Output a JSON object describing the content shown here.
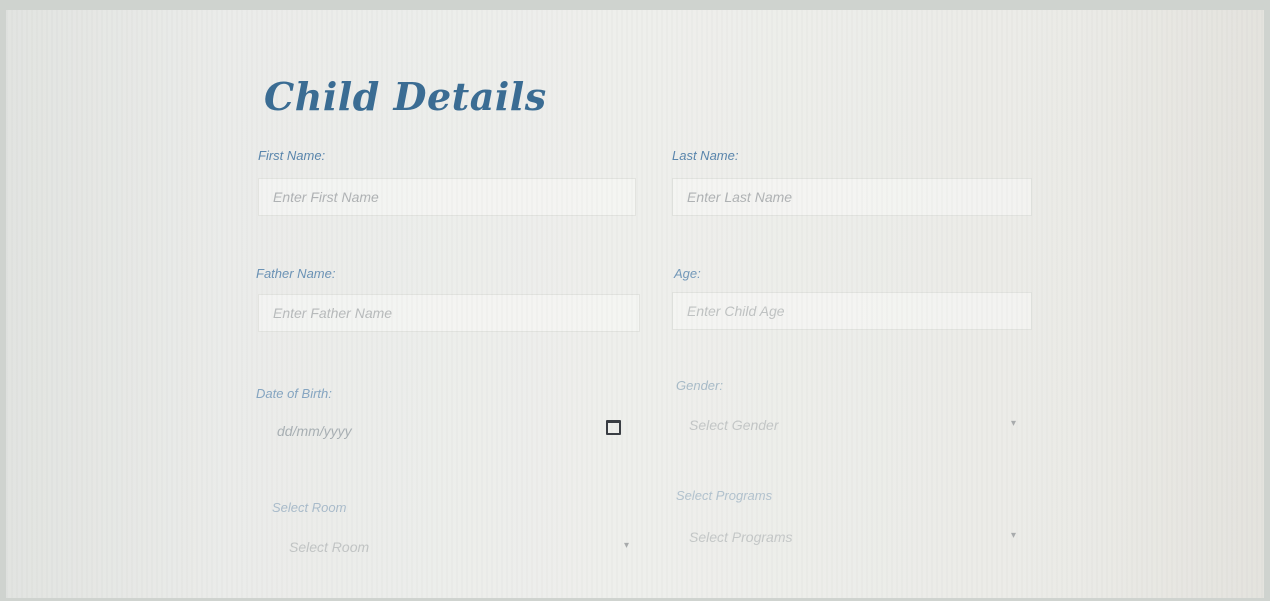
{
  "form": {
    "title": "Child Details",
    "first_name": {
      "label": "First Name:",
      "placeholder": "Enter First Name"
    },
    "last_name": {
      "label": "Last Name:",
      "placeholder": "Enter Last Name"
    },
    "father_name": {
      "label": "Father Name:",
      "placeholder": "Enter Father Name"
    },
    "age": {
      "label": "Age:",
      "placeholder": "Enter Child Age"
    },
    "dob": {
      "label": "Date of Birth:",
      "placeholder": "dd/mm/yyyy"
    },
    "gender": {
      "label": "Gender:",
      "selected": "Select Gender"
    },
    "room": {
      "label": "Select Room",
      "selected": "Select Room"
    },
    "programs": {
      "label": "Select Programs",
      "selected": "Select Programs"
    }
  },
  "icons": {
    "calendar": "calendar-icon",
    "chevron": "chevron-down-icon"
  },
  "colors": {
    "title": "#3b6d94",
    "label": "#5a86ad",
    "placeholder": "#b3b6b7"
  }
}
